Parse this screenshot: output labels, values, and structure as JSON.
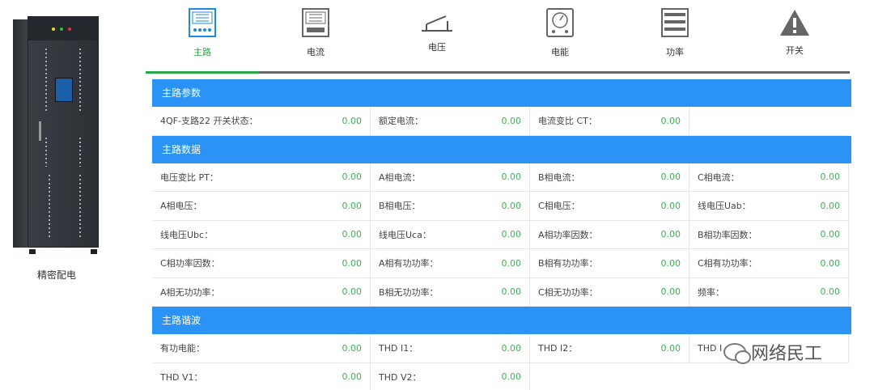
{
  "device": {
    "name": "精密配电"
  },
  "nav": {
    "tabs": [
      {
        "label": "主路",
        "icon": "grid-panel-icon",
        "active": true
      },
      {
        "label": "电流",
        "icon": "breaker-panel-icon",
        "active": false
      },
      {
        "label": "电压",
        "icon": "switch-lever-icon",
        "active": false
      },
      {
        "label": "电能",
        "icon": "meter-gauge-icon",
        "active": false
      },
      {
        "label": "功率",
        "icon": "list-bars-icon",
        "active": false
      },
      {
        "label": "开关",
        "icon": "warning-triangle-icon",
        "active": false
      }
    ]
  },
  "sections": {
    "params": {
      "title": "主路参数",
      "rows": [
        [
          {
            "label": "4QF-支路22 开关状态：",
            "value": "0.00"
          },
          {
            "label": "额定电流：",
            "value": "0.00"
          },
          {
            "label": "电流变比 CT：",
            "value": "0.00"
          },
          {
            "label": "",
            "value": ""
          }
        ]
      ]
    },
    "data": {
      "title": "主路数据",
      "rows": [
        [
          {
            "label": "电压变比 PT：",
            "value": "0.00"
          },
          {
            "label": "A相电流：",
            "value": "0.00"
          },
          {
            "label": "B相电流：",
            "value": "0.00"
          },
          {
            "label": "C相电流：",
            "value": "0.00"
          }
        ],
        [
          {
            "label": "A相电压：",
            "value": "0.00"
          },
          {
            "label": "B相电压：",
            "value": "0.00"
          },
          {
            "label": "C相电压：",
            "value": "0.00"
          },
          {
            "label": "线电压Uab：",
            "value": "0.00"
          }
        ],
        [
          {
            "label": "线电压Ubc：",
            "value": "0.00"
          },
          {
            "label": "线电压Uca：",
            "value": "0.00"
          },
          {
            "label": "A相功率因数：",
            "value": "0.00"
          },
          {
            "label": "B相功率因数：",
            "value": "0.00"
          }
        ],
        [
          {
            "label": "C相功率因数：",
            "value": "0.00"
          },
          {
            "label": "A相有功功率：",
            "value": "0.00"
          },
          {
            "label": "B相有功功率：",
            "value": "0.00"
          },
          {
            "label": "C相有功功率：",
            "value": "0.00"
          }
        ],
        [
          {
            "label": "A相无功功率：",
            "value": "0.00"
          },
          {
            "label": "B相无功功率：",
            "value": "0.00"
          },
          {
            "label": "C相无功功率：",
            "value": "0.00"
          },
          {
            "label": "频率：",
            "value": "0.00"
          }
        ]
      ]
    },
    "harmonics": {
      "title": "主路谐波",
      "rows": [
        [
          {
            "label": "有功电能：",
            "value": "0.00"
          },
          {
            "label": "THD I1：",
            "value": "0.00"
          },
          {
            "label": "THD I2：",
            "value": "0.00"
          },
          {
            "label": "THD I",
            "value": ""
          }
        ],
        [
          {
            "label": "THD V1：",
            "value": "0.00"
          },
          {
            "label": "THD V2：",
            "value": "0.00"
          },
          {
            "label": "",
            "value": ""
          },
          {
            "label": "",
            "value": ""
          }
        ]
      ]
    }
  },
  "watermark": {
    "text": "网络民工"
  },
  "colors": {
    "accent_green": "#27a745",
    "header_blue": "#2b93f5",
    "value_green": "#3cb054"
  }
}
